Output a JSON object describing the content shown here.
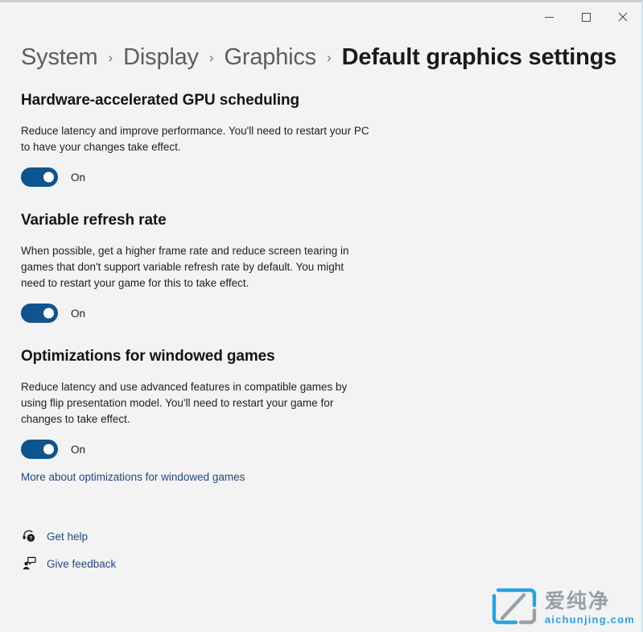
{
  "window": {
    "controls": [
      {
        "name": "minimize",
        "label": "Minimize",
        "glyph": "minimize-icon"
      },
      {
        "name": "maximize",
        "label": "Maximize",
        "glyph": "maximize-icon"
      },
      {
        "name": "close",
        "label": "Close",
        "glyph": "close-icon"
      }
    ]
  },
  "breadcrumb": {
    "separator": "›",
    "items": [
      {
        "label": "System",
        "current": false
      },
      {
        "label": "Display",
        "current": false
      },
      {
        "label": "Graphics",
        "current": false
      },
      {
        "label": "Default graphics settings",
        "current": true
      }
    ]
  },
  "sections": [
    {
      "title": "Hardware-accelerated GPU scheduling",
      "description": "Reduce latency and improve performance. You'll need to restart your PC\nto have your changes take effect.",
      "toggle": {
        "state": "On",
        "checked": true
      },
      "link": null
    },
    {
      "title": "Variable refresh rate",
      "description": "When possible, get a higher frame rate and reduce screen tearing in\ngames that don't support variable refresh rate by default. You might\nneed to restart your game for this to take effect.",
      "toggle": {
        "state": "On",
        "checked": true
      },
      "link": null
    },
    {
      "title": "Optimizations for windowed games",
      "description": "Reduce latency and use advanced features in compatible games by\nusing flip presentation model. You'll need to restart your game for\nchanges to take effect.",
      "toggle": {
        "state": "On",
        "checked": true
      },
      "link": "More about optimizations for windowed games"
    }
  ],
  "footer": {
    "links": [
      {
        "label": "Get help",
        "icon": "help-headset-icon"
      },
      {
        "label": "Give feedback",
        "icon": "feedback-person-icon"
      }
    ]
  },
  "watermark": {
    "chinese": "爱纯净",
    "domain": "aichunjing.com",
    "logo_color": "#29a3e0",
    "logo_accent": "#9aa0a6"
  },
  "colors": {
    "page_background": "#f3f3f3",
    "accent": "#0f548c",
    "link": "#21497d",
    "heading": "#141414",
    "body_text": "#1f1f1f",
    "breadcrumb_inactive": "#5d5d5d"
  }
}
